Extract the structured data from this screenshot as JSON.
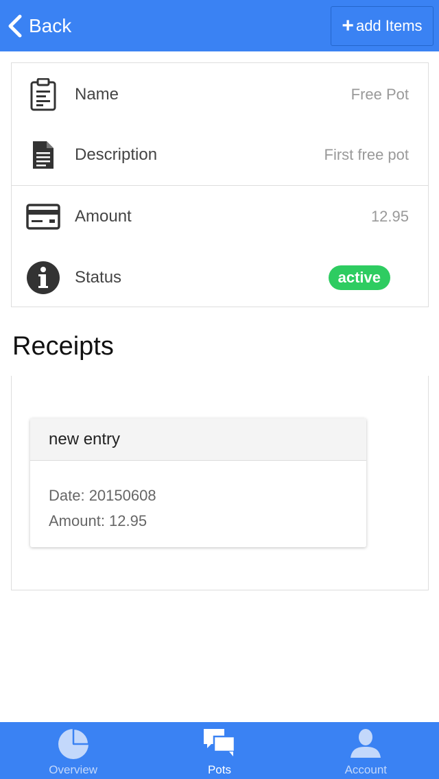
{
  "header": {
    "back_label": "Back",
    "add_label": "add Items"
  },
  "details": {
    "name_label": "Name",
    "name_value": "Free Pot",
    "description_label": "Description",
    "description_value": "First free pot",
    "amount_label": "Amount",
    "amount_value": "12.95",
    "status_label": "Status",
    "status_value": "active"
  },
  "receipts": {
    "title": "Receipts",
    "entries": [
      {
        "title": "new entry",
        "date": "Date: 20150608",
        "amount": "Amount: 12.95"
      }
    ]
  },
  "tabbar": {
    "tabs": [
      {
        "label": "Overview",
        "icon": "pie-chart-icon",
        "active": false
      },
      {
        "label": "Pots",
        "icon": "chat-bubbles-icon",
        "active": true
      },
      {
        "label": "Account",
        "icon": "user-icon",
        "active": false
      }
    ]
  },
  "colors": {
    "primary": "#3a82f3",
    "active_badge": "#2ecc61",
    "icon_dark": "#333333"
  }
}
